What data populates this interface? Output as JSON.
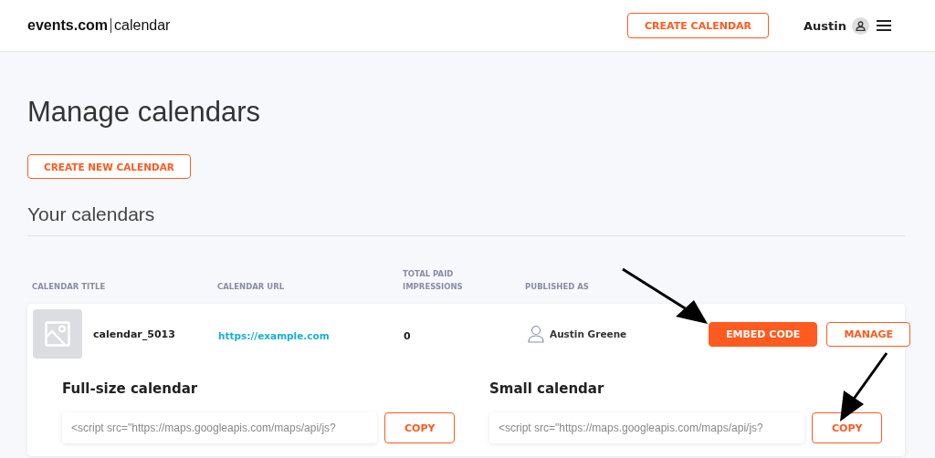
{
  "header": {
    "logo_brand": "events.com",
    "logo_product": "calendar",
    "create_button": "CREATE CALENDAR",
    "user_name": "Austin"
  },
  "page_title": "Manage calendars",
  "create_new_button": "CREATE NEW CALENDAR",
  "section_title": "Your calendars",
  "table": {
    "columns": [
      "CALENDAR TITLE",
      "CALENDAR URL",
      "TOTAL PAID IMPRESSIONS",
      "PUBLISHED AS"
    ],
    "rows": [
      {
        "title": "calendar_5013",
        "url": "https://example.com",
        "impressions": "0",
        "published_as": "Austin Greene",
        "embed_button": "EMBED CODE",
        "manage_button": "MANAGE",
        "expanded": true,
        "embeds": [
          {
            "heading": "Full-size calendar",
            "code": "<script src=\"https://maps.googleapis.com/maps/api/js?",
            "button": "COPY"
          },
          {
            "heading": "Small calendar",
            "code": "<script src=\"https://maps.googleapis.com/maps/api/js?",
            "button": "COPY"
          }
        ]
      }
    ]
  }
}
